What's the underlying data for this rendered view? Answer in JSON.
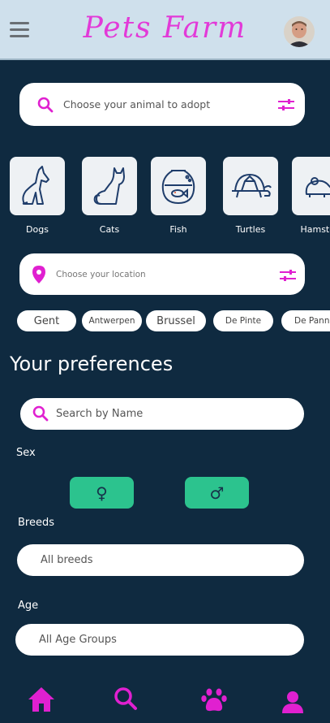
{
  "header": {
    "title": "Pets Farm"
  },
  "search": {
    "placeholder": "Choose your animal to adopt"
  },
  "animals": [
    {
      "label": "Dogs"
    },
    {
      "label": "Cats"
    },
    {
      "label": "Fish"
    },
    {
      "label": "Turtles"
    },
    {
      "label": "Hamster"
    }
  ],
  "location": {
    "placeholder": "Choose your location"
  },
  "cities": [
    {
      "label": "Gent"
    },
    {
      "label": "Antwerpen"
    },
    {
      "label": "Brussel"
    },
    {
      "label": "De Pinte"
    },
    {
      "label": "De Panne"
    }
  ],
  "preferences": {
    "title": "Your preferences",
    "name_search": {
      "placeholder": "Search by Name"
    },
    "sex_label": "Sex",
    "sex_options": [
      {
        "symbol": "♀"
      },
      {
        "symbol": "♂"
      }
    ],
    "breeds_label": "Breeds",
    "breeds_value": "All breeds",
    "age_label": "Age",
    "age_value": "All Age Groups"
  },
  "colors": {
    "accent": "#e020d0",
    "background": "#0f2a40",
    "header": "#cfe0ec",
    "sex_button": "#2cc38e"
  },
  "bottom_nav": [
    {
      "icon": "home-icon"
    },
    {
      "icon": "search-icon"
    },
    {
      "icon": "paw-icon"
    },
    {
      "icon": "user-icon"
    }
  ]
}
